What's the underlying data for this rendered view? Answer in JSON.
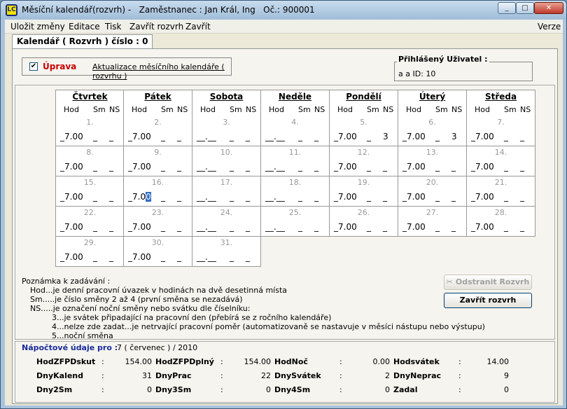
{
  "window": {
    "title": "Měsíční kalendář(rozvrh) -   Zaměstnanec : Jan Král, Ing   Oč.: 900001",
    "icon_label": "LC",
    "controls": [
      "minimize",
      "maximize",
      "close"
    ]
  },
  "menu": {
    "items": [
      {
        "label": "Uložit změny"
      },
      {
        "label": "Editace"
      },
      {
        "label": "Tisk"
      },
      {
        "label": "Zavřít rozvrh"
      },
      {
        "label": "Zavřít"
      }
    ],
    "right_item": "Verze"
  },
  "tab": {
    "label": "Kalendář ( Rozvrh ) číslo : 0"
  },
  "header": {
    "checkbox_checked": true,
    "checkbox_mark": "✔",
    "uprava_label": "Úprava",
    "aktualizace_label": "Aktualizace měsíčního kalendáře ( rozvrhu )",
    "user_label": "Přihlášený Uživatel :",
    "user_value": "a a ID: 10"
  },
  "calendar": {
    "col_labels": {
      "hod": "Hod",
      "sm": "Sm",
      "ns": "NS"
    },
    "days": [
      "Čtvrtek",
      "Pátek",
      "Sobota",
      "Neděle",
      "Pondělí",
      "Úterý",
      "Středa"
    ],
    "weeks": [
      [
        {
          "d": "1.",
          "hod": "_7.00",
          "sm": "_",
          "ns": "_"
        },
        {
          "d": "2.",
          "hod": "_7.00",
          "sm": "_",
          "ns": "_"
        },
        {
          "d": "3.",
          "hod": "__.__",
          "sm": "_",
          "ns": "_"
        },
        {
          "d": "4.",
          "hod": "__.__",
          "sm": "_",
          "ns": "_"
        },
        {
          "d": "5.",
          "hod": "_7.00",
          "sm": "_",
          "ns": "3"
        },
        {
          "d": "6.",
          "hod": "_7.00",
          "sm": "_",
          "ns": "3"
        },
        {
          "d": "7.",
          "hod": "_7.00",
          "sm": "_",
          "ns": "_"
        }
      ],
      [
        {
          "d": "8.",
          "hod": "_7.00",
          "sm": "_",
          "ns": "_"
        },
        {
          "d": "9.",
          "hod": "_7.00",
          "sm": "_",
          "ns": "_"
        },
        {
          "d": "10.",
          "hod": "__.__",
          "sm": "_",
          "ns": "_"
        },
        {
          "d": "11.",
          "hod": "__.__",
          "sm": "_",
          "ns": "_"
        },
        {
          "d": "12.",
          "hod": "_7.00",
          "sm": "_",
          "ns": "_"
        },
        {
          "d": "13.",
          "hod": "_7.00",
          "sm": "_",
          "ns": "_"
        },
        {
          "d": "14.",
          "hod": "_7.00",
          "sm": "_",
          "ns": "_"
        }
      ],
      [
        {
          "d": "15.",
          "hod": "_7.00",
          "sm": "_",
          "ns": "_"
        },
        {
          "d": "16.",
          "hod": "_7.00",
          "sm": "_",
          "ns": "_",
          "editing": true
        },
        {
          "d": "17.",
          "hod": "__.__",
          "sm": "_",
          "ns": "_"
        },
        {
          "d": "18.",
          "hod": "__.__",
          "sm": "_",
          "ns": "_"
        },
        {
          "d": "19.",
          "hod": "_7.00",
          "sm": "_",
          "ns": "_"
        },
        {
          "d": "20.",
          "hod": "_7.00",
          "sm": "_",
          "ns": "_"
        },
        {
          "d": "21.",
          "hod": "_7.00",
          "sm": "_",
          "ns": "_"
        }
      ],
      [
        {
          "d": "22.",
          "hod": "_7.00",
          "sm": "_",
          "ns": "_"
        },
        {
          "d": "23.",
          "hod": "_7.00",
          "sm": "_",
          "ns": "_"
        },
        {
          "d": "24.",
          "hod": "__.__",
          "sm": "_",
          "ns": "_"
        },
        {
          "d": "25.",
          "hod": "__.__",
          "sm": "_",
          "ns": "_"
        },
        {
          "d": "26.",
          "hod": "_7.00",
          "sm": "_",
          "ns": "_"
        },
        {
          "d": "27.",
          "hod": "_7.00",
          "sm": "_",
          "ns": "_"
        },
        {
          "d": "28.",
          "hod": "_7.00",
          "sm": "_",
          "ns": "_"
        }
      ],
      [
        {
          "d": "29.",
          "hod": "_7.00",
          "sm": "_",
          "ns": "_"
        },
        {
          "d": "30.",
          "hod": "_7.00",
          "sm": "_",
          "ns": "_"
        },
        {
          "d": "31.",
          "hod": "__.__",
          "sm": "_",
          "ns": "_"
        }
      ]
    ]
  },
  "notes": [
    "Poznámka k zadávání :",
    "Hod...je denní pracovní úvazek v hodinách na dvě desetinná místa",
    "Sm.....je číslo směny 2 až 4 (první směna se nezadává)",
    "NS.....je označení noční směny nebo svátku dle číselníku:",
    "3...je svátek připadající na pracovní den (přebírá se z ročního kalendáře)",
    "4...nelze zde zadat...je netrvající pracovní  poměr (automatizovaně se nastavuje  v měsíci nástupu nebo výstupu)",
    "5...noční směna"
  ],
  "buttons": {
    "odstranit": "Odstranit Rozvrh",
    "zavrit": "Zavřít rozvrh"
  },
  "napocet": {
    "title": "Nápočtové údaje pro :",
    "period": "7 ( červenec ) / 2010",
    "rows": [
      [
        {
          "label": "HodZFPDskut",
          "value": "154.00"
        },
        {
          "label": "HodZFPDplný",
          "value": "154.00"
        },
        {
          "label": "HodNoč",
          "value": "0.00"
        },
        {
          "label": "Hodsvátek",
          "value": "14.00"
        }
      ],
      [
        {
          "label": "DnyKalend",
          "value": "31"
        },
        {
          "label": "DnyPrac",
          "value": "22"
        },
        {
          "label": "DnySvátek",
          "value": "2"
        },
        {
          "label": "DnyNeprac",
          "value": "9"
        }
      ],
      [
        {
          "label": "Dny2Sm",
          "value": "0"
        },
        {
          "label": "Dny3Sm",
          "value": "0"
        },
        {
          "label": "Dny4Sm",
          "value": "0"
        },
        {
          "label": "Zadal",
          "value": "0"
        }
      ]
    ]
  }
}
